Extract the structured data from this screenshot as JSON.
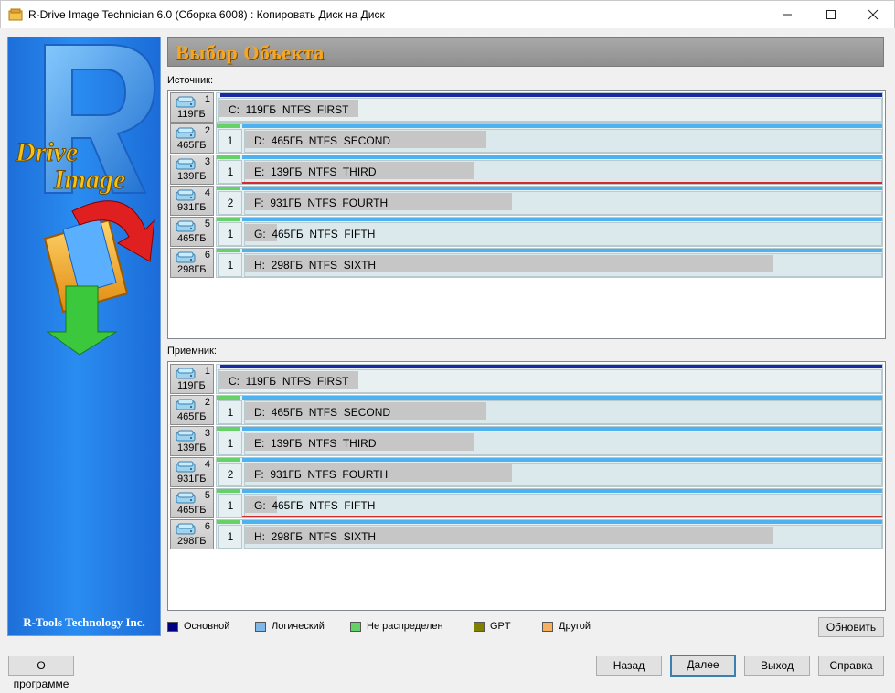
{
  "window": {
    "title": "R-Drive Image Technician 6.0 (Сборка 6008) : Копировать Диск на Диск"
  },
  "sidebar": {
    "company": "R-Tools Technology Inc.",
    "logo_word1": "Drive",
    "logo_word2": "Image"
  },
  "header": {
    "title": "Выбор Объекта"
  },
  "source": {
    "label": "Источник:",
    "disks": [
      {
        "num": "1",
        "size": "119ГБ",
        "partition": "C:  119ГБ  NTFS  FIRST",
        "order": "",
        "used": 0.21,
        "type": "primary",
        "selected": false
      },
      {
        "num": "2",
        "size": "465ГБ",
        "partition": "D:  465ГБ  NTFS  SECOND",
        "order": "1",
        "used": 0.38,
        "type": "logical",
        "selected": false
      },
      {
        "num": "3",
        "size": "139ГБ",
        "partition": "E:  139ГБ  NTFS  THIRD",
        "order": "1",
        "used": 0.36,
        "type": "logical",
        "selected": true
      },
      {
        "num": "4",
        "size": "931ГБ",
        "partition": "F:  931ГБ  NTFS  FOURTH",
        "order": "2",
        "used": 0.42,
        "type": "logical",
        "selected": false
      },
      {
        "num": "5",
        "size": "465ГБ",
        "partition": "G:  465ГБ  NTFS  FIFTH",
        "order": "1",
        "used": 0.05,
        "type": "logical",
        "selected": false
      },
      {
        "num": "6",
        "size": "298ГБ",
        "partition": "H:  298ГБ  NTFS  SIXTH",
        "order": "1",
        "used": 0.83,
        "type": "logical",
        "selected": false
      }
    ]
  },
  "target": {
    "label": "Приемник:",
    "disks": [
      {
        "num": "1",
        "size": "119ГБ",
        "partition": "C:  119ГБ  NTFS  FIRST",
        "order": "",
        "used": 0.21,
        "type": "primary",
        "selected": false
      },
      {
        "num": "2",
        "size": "465ГБ",
        "partition": "D:  465ГБ  NTFS  SECOND",
        "order": "1",
        "used": 0.38,
        "type": "logical",
        "selected": false
      },
      {
        "num": "3",
        "size": "139ГБ",
        "partition": "E:  139ГБ  NTFS  THIRD",
        "order": "1",
        "used": 0.36,
        "type": "logical",
        "selected": false
      },
      {
        "num": "4",
        "size": "931ГБ",
        "partition": "F:  931ГБ  NTFS  FOURTH",
        "order": "2",
        "used": 0.42,
        "type": "logical",
        "selected": false
      },
      {
        "num": "5",
        "size": "465ГБ",
        "partition": "G:  465ГБ  NTFS  FIFTH",
        "order": "1",
        "used": 0.05,
        "type": "logical",
        "selected": true
      },
      {
        "num": "6",
        "size": "298ГБ",
        "partition": "H:  298ГБ  NTFS  SIXTH",
        "order": "1",
        "used": 0.83,
        "type": "logical",
        "selected": false
      }
    ]
  },
  "legend": [
    {
      "label": "Основной",
      "color": "#000080"
    },
    {
      "label": "Логический",
      "color": "#7fb8e8"
    },
    {
      "label": "Не распределен",
      "color": "#66d166"
    },
    {
      "label": "GPT",
      "color": "#808000"
    },
    {
      "label": "Другой",
      "color": "#f8b060"
    }
  ],
  "buttons": {
    "refresh": "Обновить",
    "about": "О программе",
    "back": "Назад",
    "next": "Далее",
    "exit": "Выход",
    "help": "Справка"
  },
  "colors": {
    "primary_strip": "#1a2aa0",
    "logical_strip": "#4fb2f0",
    "selection": "#d42a2a"
  }
}
